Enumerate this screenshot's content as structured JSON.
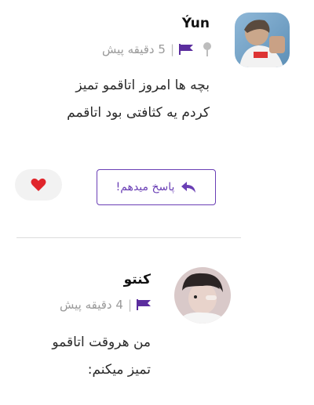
{
  "comments": [
    {
      "username": "Ýun",
      "time": "5 دقیقه پیش",
      "separator": "|",
      "lines": [
        "بچه ها امروز اتاقمو تمیز",
        "کردم یه کثافتی بود اتاقمم"
      ],
      "reply_label": "پاسخ میدهم!",
      "like_icon": "heart-icon",
      "pin_icon": "pin-icon",
      "flag_icon": "flag-icon"
    },
    {
      "username": "کنتو",
      "time": "4 دقیقه پیش",
      "separator": "|",
      "lines": [
        "من هروقت اتاقمو",
        "تمیز میکنم:"
      ],
      "flag_icon": "flag-icon"
    }
  ],
  "colors": {
    "accent": "#6a3fb5",
    "flag": "#5b2d9e",
    "heart": "#e0252b",
    "meta": "#9a9a9a"
  }
}
